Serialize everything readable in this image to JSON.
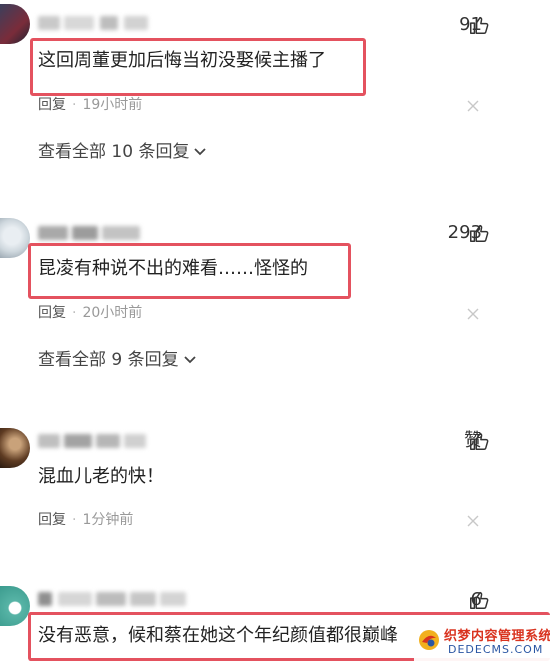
{
  "comments": [
    {
      "likes": "91",
      "text": "这回周董更加后悔当初没娶候主播了",
      "reply_label": "回复",
      "time": "19小时前",
      "view_all": "查看全部 10 条回复"
    },
    {
      "likes": "293",
      "text": "昆凌有种说不出的难看……怪怪的",
      "reply_label": "回复",
      "time": "20小时前",
      "view_all": "查看全部 9 条回复"
    },
    {
      "likes": "赞",
      "text": "混血儿老的快！",
      "reply_label": "回复",
      "time": "1分钟前"
    },
    {
      "likes": "6",
      "text": "没有恶意，候和蔡在她这个年纪颜值都很巅峰"
    }
  ],
  "meta_separator": "·",
  "watermark": {
    "title": "织梦内容管理系统",
    "subtitle": "DEDECMS.COM"
  },
  "colors": {
    "highlight_box": "#e4525f",
    "text": "#222222",
    "muted": "#999999"
  },
  "icons": [
    "thumbs-up-icon",
    "close-icon",
    "chevron-down-icon"
  ]
}
